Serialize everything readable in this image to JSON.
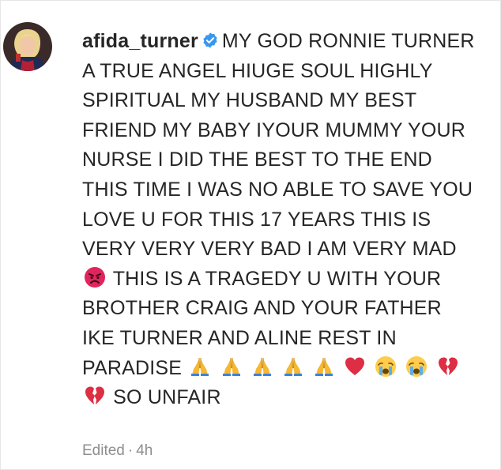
{
  "comment": {
    "username": "afida_turner",
    "verified_icon": "verified-badge-icon",
    "text_part1": "MY GOD RONNIE TURNER A TRUE ANGEL HIUGE SOUL HIGHLY SPIRITUAL MY HUSBAND MY BEST FRIEND MY BABY IYOUR MUMMY YOUR NURSE I DID THE BEST TO THE END THIS TIME I WAS NO ABLE TO SAVE YOU LOVE U FOR THIS 17 YEARS THIS IS VERY VERY VERY BAD I AM VERY MAD",
    "text_part2": "THIS IS A TRAGEDY U WITH YOUR BROTHER CRAIG AND YOUR FATHER IKE TURNER AND ALINE REST IN PARADISE",
    "text_part3": "SO UNFAIR",
    "emojis": [
      "angry-face-icon",
      "folded-hands-icon",
      "red-heart-icon",
      "crying-face-icon",
      "broken-heart-icon"
    ]
  },
  "meta": {
    "edited": "Edited",
    "separator": "·",
    "time": "4h"
  },
  "colors": {
    "text": "#262626",
    "meta": "#8e8e8e",
    "verified": "#3897f0"
  }
}
